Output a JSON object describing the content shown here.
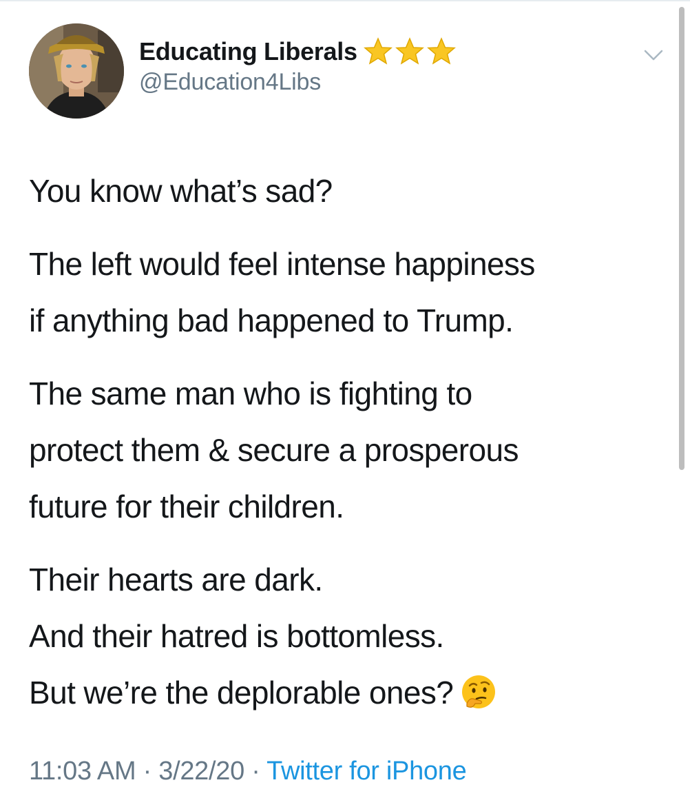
{
  "tweet": {
    "display_name": "Educating Liberals",
    "handle": "@Education4Libs",
    "badges": [
      "star-icon",
      "star-icon",
      "star-icon"
    ],
    "body": {
      "line1": "You know what’s sad?",
      "line2a": "The left would feel intense happiness",
      "line2b": "if anything bad happened to Trump.",
      "line3a": "The same man who is fighting to",
      "line3b": "protect them & secure a prosperous",
      "line3c": "future for their children.",
      "line4a": "Their hearts are dark.",
      "line4b": "And their hatred is bottomless.",
      "line4c": "But we’re the deplorable ones?",
      "emoji": "thinking-face-icon"
    },
    "time": "11:03 AM",
    "date": "3/22/20",
    "separator": "·",
    "source": "Twitter for iPhone"
  },
  "colors": {
    "text": "#14171a",
    "secondary": "#657786",
    "link": "#1b95e0",
    "star": "#f9c623"
  }
}
